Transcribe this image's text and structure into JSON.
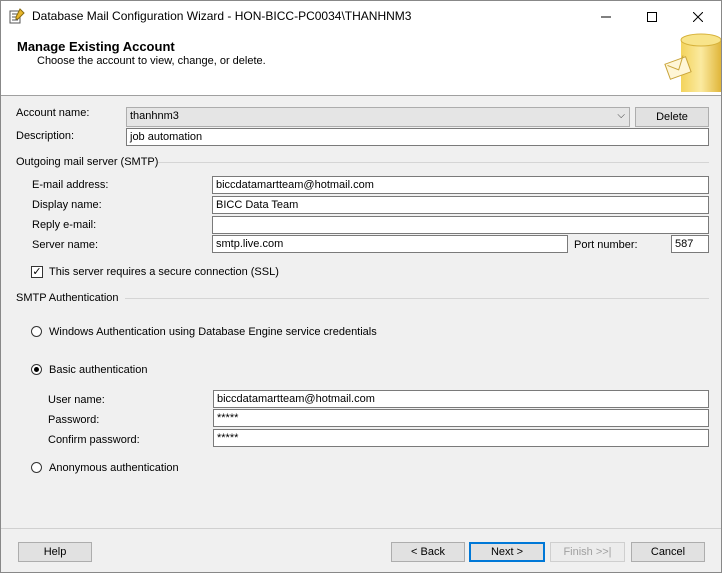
{
  "window": {
    "title": "Database Mail Configuration Wizard - HON-BICC-PC0034\\THANHNM3",
    "minimize_icon": "minimize-icon",
    "maximize_icon": "maximize-icon",
    "close_icon": "close-icon"
  },
  "header": {
    "title": "Manage Existing Account",
    "subtitle": "Choose the account to view, change, or delete."
  },
  "account": {
    "name_label": "Account name:",
    "name_value": "thanhnm3",
    "delete_label": "Delete",
    "description_label": "Description:",
    "description_value": "job automation"
  },
  "smtp": {
    "group_label": "Outgoing mail server (SMTP)",
    "email_label": "E-mail address:",
    "email_value": "biccdatamartteam@hotmail.com",
    "display_label": "Display name:",
    "display_value": "BICC Data Team",
    "reply_label": "Reply e-mail:",
    "reply_value": "",
    "server_label": "Server name:",
    "server_value": "smtp.live.com",
    "port_label": "Port number:",
    "port_value": "587",
    "ssl_label": "This server requires a secure connection (SSL)",
    "ssl_checked": true
  },
  "auth": {
    "group_label": "SMTP Authentication",
    "windows_label": "Windows Authentication using Database Engine service credentials",
    "basic_label": "Basic authentication",
    "selected": "basic",
    "user_label": "User name:",
    "user_value": "biccdatamartteam@hotmail.com",
    "password_label": "Password:",
    "password_value": "*****",
    "confirm_label": "Confirm password:",
    "confirm_value": "*****",
    "anonymous_label": "Anonymous authentication"
  },
  "footer": {
    "help_label": "Help",
    "back_label": "< Back",
    "next_label": "Next >",
    "finish_label": "Finish >>|",
    "cancel_label": "Cancel"
  }
}
